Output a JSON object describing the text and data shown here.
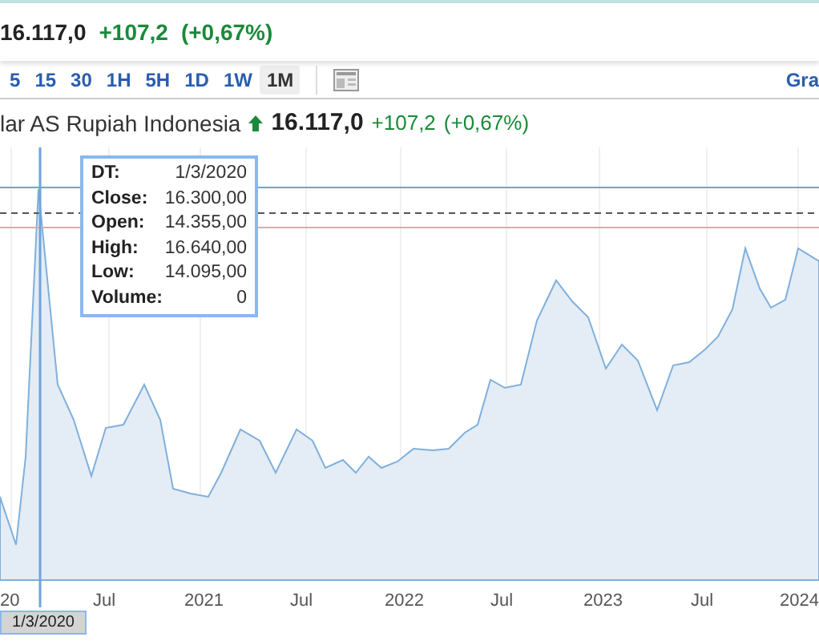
{
  "header": {
    "price": "16.117,0",
    "change": "+107,2",
    "change_percent": "(+0,67%)"
  },
  "toolbar": {
    "intervals": [
      {
        "label": "5",
        "selected": false
      },
      {
        "label": "15",
        "selected": false
      },
      {
        "label": "30",
        "selected": false
      },
      {
        "label": "1H",
        "selected": false
      },
      {
        "label": "5H",
        "selected": false
      },
      {
        "label": "1D",
        "selected": false
      },
      {
        "label": "1W",
        "selected": false
      },
      {
        "label": "1M",
        "selected": true
      }
    ],
    "right_link": "Gra"
  },
  "legend": {
    "name": "lar AS Rupiah Indonesia",
    "rising": true,
    "price": "16.117,0",
    "change": "+107,2",
    "change_percent": "(+0,67%)"
  },
  "tooltip": [
    {
      "label": "DT:",
      "value": "1/3/2020"
    },
    {
      "label": "Close:",
      "value": "16.300,00"
    },
    {
      "label": "Open:",
      "value": "14.355,00"
    },
    {
      "label": "High:",
      "value": "16.640,00"
    },
    {
      "label": "Low:",
      "value": "14.095,00"
    },
    {
      "label": "Volume:",
      "value": "0"
    }
  ],
  "x_axis_labels": [
    "20",
    "Jul",
    "2021",
    "Jul",
    "2022",
    "Jul",
    "2023",
    "Jul",
    "2024"
  ],
  "crosshair_date": "1/3/2020"
}
